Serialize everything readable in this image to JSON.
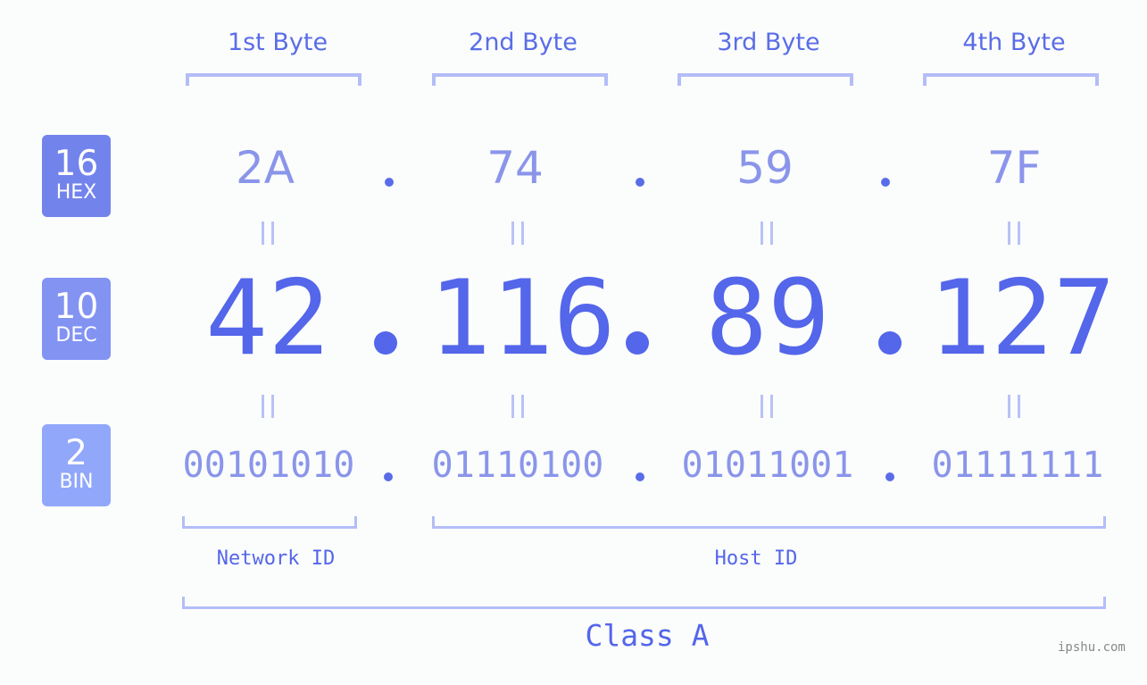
{
  "bytes": [
    {
      "title": "1st Byte",
      "hex": "2A",
      "dec": "42",
      "bin": "00101010"
    },
    {
      "title": "2nd Byte",
      "hex": "74",
      "dec": "116",
      "bin": "01110100"
    },
    {
      "title": "3rd Byte",
      "hex": "59",
      "dec": "89",
      "bin": "01011001"
    },
    {
      "title": "4th Byte",
      "hex": "7F",
      "dec": "127",
      "bin": "01111111"
    }
  ],
  "badges": {
    "hex": {
      "num": "16",
      "label": "HEX",
      "color": "#7383ec"
    },
    "dec": {
      "num": "10",
      "label": "DEC",
      "color": "#8393f2"
    },
    "bin": {
      "num": "2",
      "label": "BIN",
      "color": "#90a7fa"
    }
  },
  "separator": ".",
  "network_id_label": "Network ID",
  "host_id_label": "Host ID",
  "class_label": "Class A",
  "watermark": "ipshu.com",
  "colors": {
    "accent": "#5466ea",
    "light": "#8a95ea",
    "bracket": "#b3bdf8"
  }
}
